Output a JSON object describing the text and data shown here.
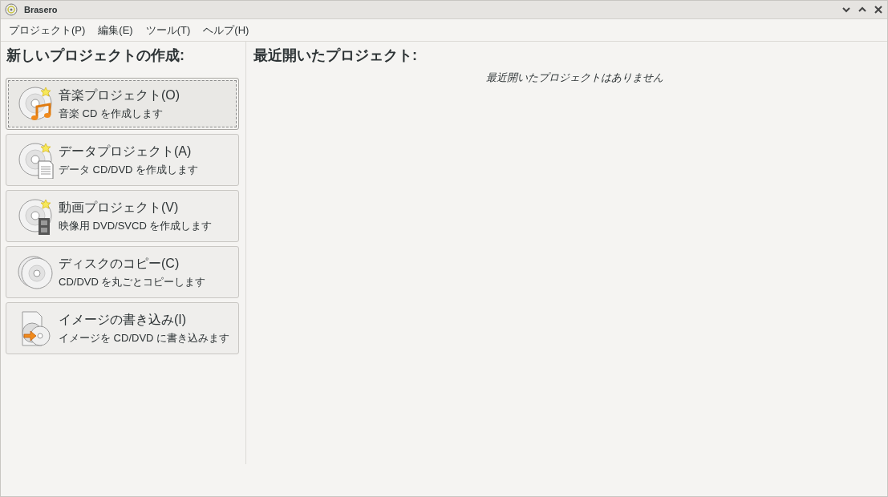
{
  "window": {
    "title": "Brasero"
  },
  "menu": [
    "プロジェクト(P)",
    "編集(E)",
    "ツール(T)",
    "ヘルプ(H)"
  ],
  "new_project": {
    "heading": "新しいプロジェクトの作成:",
    "buttons": [
      {
        "kind": "audio",
        "title": "音楽プロジェクト(O)",
        "subtitle": "音楽 CD を作成します",
        "focused": true
      },
      {
        "kind": "data",
        "title": "データプロジェクト(A)",
        "subtitle": "データ CD/DVD を作成します",
        "focused": false
      },
      {
        "kind": "video",
        "title": "動画プロジェクト(V)",
        "subtitle": "映像用 DVD/SVCD を作成します",
        "focused": false
      },
      {
        "kind": "copy",
        "title": "ディスクのコピー(C)",
        "subtitle": "CD/DVD を丸ごとコピーします",
        "focused": false
      },
      {
        "kind": "image",
        "title": "イメージの書き込み(I)",
        "subtitle": "イメージを CD/DVD に書き込みます",
        "focused": false
      }
    ]
  },
  "recent": {
    "heading": "最近開いたプロジェクト:",
    "empty_message": "最近開いたプロジェクトはありません"
  }
}
